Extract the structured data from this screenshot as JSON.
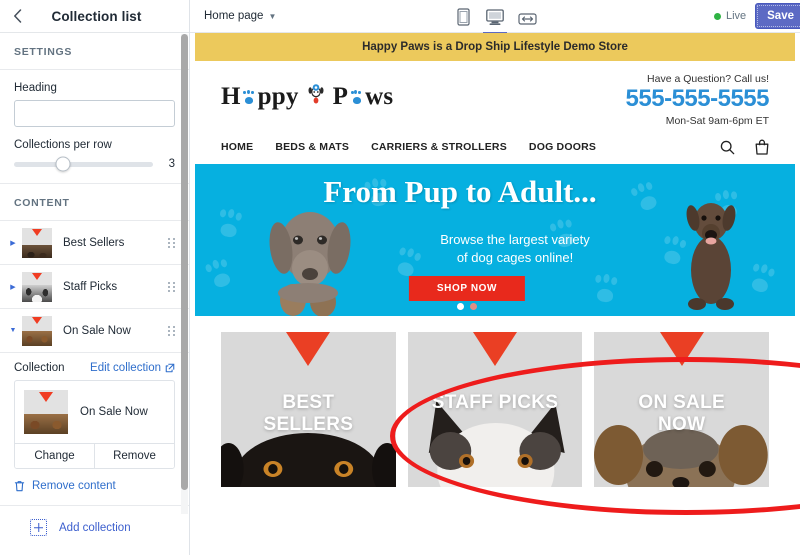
{
  "sidebar": {
    "back_icon": "chevron-left-icon",
    "title": "Collection list",
    "settings_label": "SETTINGS",
    "heading_field": {
      "label": "Heading",
      "value": "",
      "placeholder": ""
    },
    "slider": {
      "label": "Collections per row",
      "value": "3",
      "position_pct": 35
    },
    "content_label": "CONTENT",
    "collections": [
      {
        "name": "Best Sellers",
        "expanded": false
      },
      {
        "name": "Staff Picks",
        "expanded": false
      },
      {
        "name": "On Sale Now",
        "expanded": true
      }
    ],
    "collection_detail": {
      "label": "Collection",
      "edit_link": "Edit collection",
      "selected_name": "On Sale Now",
      "change_label": "Change",
      "remove_label": "Remove"
    },
    "remove_content_label": "Remove content",
    "add_collection_label": "Add collection"
  },
  "topbar": {
    "page_name": "Home page",
    "devices": [
      {
        "name": "mobile-view",
        "active": false
      },
      {
        "name": "desktop-view",
        "active": true
      },
      {
        "name": "fullscreen-view",
        "active": false
      }
    ],
    "live_label": "Live",
    "save_label": "Save"
  },
  "store": {
    "promo_text": "Happy Paws is a Drop Ship Lifestyle Demo Store",
    "logo": {
      "part1": "H",
      "part2": "ppy",
      "part3": "P",
      "part4": "ws"
    },
    "contact": {
      "question": "Have a Question? Call us!",
      "phone": "555-555-5555",
      "hours": "Mon-Sat 9am-6pm ET"
    },
    "nav": [
      "HOME",
      "BEDS & MATS",
      "CARRIERS & STROLLERS",
      "DOG DOORS"
    ],
    "nav_icons": [
      "search-icon",
      "cart-icon"
    ],
    "hero": {
      "title": "From Pup to Adult...",
      "subtitle_line1": "Browse the largest variety",
      "subtitle_line2": "of dog cages online!",
      "cta": "SHOP NOW",
      "dots": 2,
      "active_dot": 0
    },
    "collection_cards": [
      {
        "line1": "BEST",
        "line2": "SELLERS"
      },
      {
        "line1": "STAFF PICKS",
        "line2": ""
      },
      {
        "line1": "ON SALE",
        "line2": "NOW"
      }
    ]
  },
  "colors": {
    "promo_yellow": "#ecc95c",
    "hero_blue": "#06b0e0",
    "cta_red": "#e8291c",
    "brand_blue": "#2b8fd6",
    "save_purple": "#5c6ac4",
    "live_green": "#2fb344",
    "annotation_red": "#ee1c1c",
    "link_blue": "#2f6ecb"
  }
}
